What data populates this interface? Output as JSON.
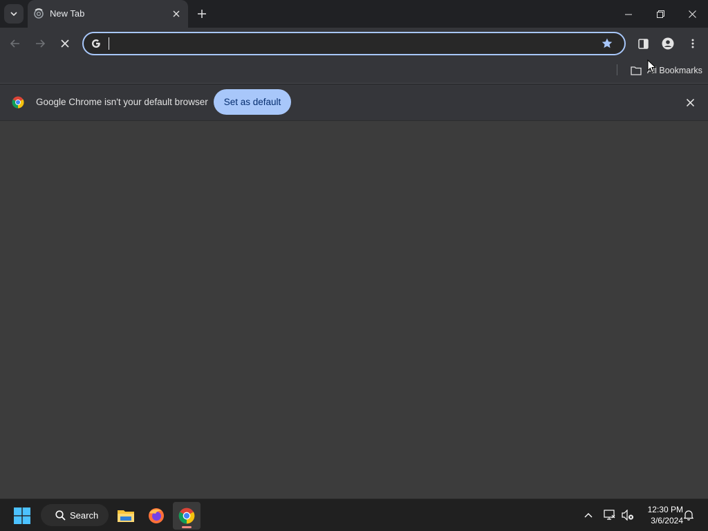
{
  "tabstrip": {
    "tab": {
      "title": "New Tab"
    }
  },
  "toolbar": {
    "omnibox": {
      "value": "",
      "placeholder": ""
    }
  },
  "bookmarks_bar": {
    "all_bookmarks_label": "All Bookmarks"
  },
  "infobar": {
    "message": "Google Chrome isn't your default browser",
    "button_label": "Set as default"
  },
  "taskbar": {
    "search_label": "Search",
    "time": "12:30 PM",
    "date": "3/6/2024"
  },
  "colors": {
    "accent": "#a8c7fa",
    "accent_text": "#062e6f",
    "content_bg": "#3c3c3c",
    "toolbar_bg": "#35363a"
  },
  "icons": [
    "tab-search-icon",
    "new-tab-icon",
    "minimize-icon",
    "restore-icon",
    "close-icon",
    "back-icon",
    "forward-icon",
    "stop-icon",
    "google-icon",
    "star-icon",
    "side-panel-icon",
    "profile-icon",
    "menu-icon",
    "folder-icon",
    "chrome-icon",
    "windows-icon",
    "search-icon",
    "file-explorer-icon",
    "firefox-icon",
    "chevron-up-icon",
    "network-icon",
    "volume-muted-icon",
    "bell-icon"
  ]
}
